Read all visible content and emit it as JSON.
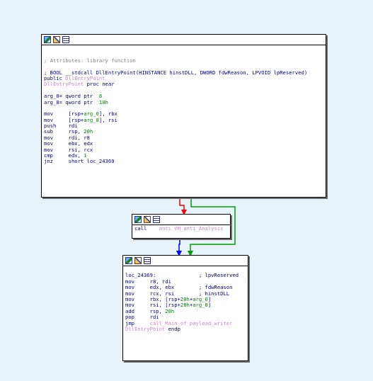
{
  "colors": {
    "background": "#e6f3fb",
    "edge_false": "#ff0000",
    "edge_true": "#00a000",
    "edge_jump": "#0000ff"
  },
  "icons": [
    "graph-icon",
    "edit-icon",
    "grid-icon"
  ],
  "block1": {
    "lines": [
      {
        "spans": []
      },
      {
        "spans": []
      },
      {
        "spans": [
          {
            "t": "; Attributes: library function",
            "c": "c-comment"
          }
        ]
      },
      {
        "spans": []
      },
      {
        "spans": [
          {
            "t": "; BOOL __stdcall DllEntryPoint(HINSTANCE hinstDLL, DWORD fdwReason, LPVOID lpReserved)",
            "c": "c-proto"
          }
        ]
      },
      {
        "spans": [
          {
            "t": "public ",
            "c": "c-kw"
          },
          {
            "t": "DllEntryPoint",
            "c": "c-func"
          }
        ]
      },
      {
        "spans": [
          {
            "t": "DllEntryPoint",
            "c": "c-func"
          },
          {
            "t": " proc near",
            "c": "c-kw"
          }
        ]
      },
      {
        "spans": []
      },
      {
        "spans": [
          {
            "t": "arg_0= qword ptr  ",
            "c": "c-kw"
          },
          {
            "t": "8",
            "c": "c-num"
          }
        ]
      },
      {
        "spans": [
          {
            "t": "arg_8= qword ptr  ",
            "c": "c-kw"
          },
          {
            "t": "10h",
            "c": "c-num"
          }
        ]
      },
      {
        "spans": []
      },
      {
        "spans": [
          {
            "t": "mov     [rsp+",
            "c": "c-kw"
          },
          {
            "t": "arg_0",
            "c": "c-var"
          },
          {
            "t": "], rbx",
            "c": "c-kw"
          }
        ]
      },
      {
        "spans": [
          {
            "t": "mov     [rsp+",
            "c": "c-kw"
          },
          {
            "t": "arg_8",
            "c": "c-var"
          },
          {
            "t": "], rsi",
            "c": "c-kw"
          }
        ]
      },
      {
        "spans": [
          {
            "t": "push    rdi",
            "c": "c-kw"
          }
        ]
      },
      {
        "spans": [
          {
            "t": "sub     rsp, ",
            "c": "c-kw"
          },
          {
            "t": "20h",
            "c": "c-num"
          }
        ]
      },
      {
        "spans": [
          {
            "t": "mov     rdi, r8",
            "c": "c-kw"
          }
        ]
      },
      {
        "spans": [
          {
            "t": "mov     ebx, edx",
            "c": "c-kw"
          }
        ]
      },
      {
        "spans": [
          {
            "t": "mov     rsi, rcx",
            "c": "c-kw"
          }
        ]
      },
      {
        "spans": [
          {
            "t": "cmp     edx, ",
            "c": "c-kw"
          },
          {
            "t": "1",
            "c": "c-num"
          }
        ]
      },
      {
        "spans": [
          {
            "t": "jnz     short loc_24369",
            "c": "c-kw"
          }
        ]
      }
    ]
  },
  "block2": {
    "lines": [
      {
        "spans": [
          {
            "t": "call    ",
            "c": "c-kw"
          },
          {
            "t": "anti_VM_anti_Analysis",
            "c": "c-func"
          }
        ]
      }
    ]
  },
  "block3": {
    "lines": [
      {
        "spans": []
      },
      {
        "spans": [
          {
            "t": "loc_24369:              ; lpvReserved",
            "c": "c-lbl"
          }
        ]
      },
      {
        "spans": [
          {
            "t": "mov     r8, rdi",
            "c": "c-kw"
          }
        ]
      },
      {
        "spans": [
          {
            "t": "mov     edx, ebx        ; fdwReason",
            "c": "c-kw"
          }
        ]
      },
      {
        "spans": [
          {
            "t": "mov     rcx, rsi        ; hinstDLL",
            "c": "c-kw"
          }
        ]
      },
      {
        "spans": [
          {
            "t": "mov     rbx, [rsp+",
            "c": "c-kw"
          },
          {
            "t": "28h",
            "c": "c-num"
          },
          {
            "t": "+",
            "c": "c-kw"
          },
          {
            "t": "arg_0",
            "c": "c-var"
          },
          {
            "t": "]",
            "c": "c-kw"
          }
        ]
      },
      {
        "spans": [
          {
            "t": "mov     rsi, [rsp+",
            "c": "c-kw"
          },
          {
            "t": "28h",
            "c": "c-num"
          },
          {
            "t": "+",
            "c": "c-kw"
          },
          {
            "t": "arg_8",
            "c": "c-var"
          },
          {
            "t": "]",
            "c": "c-kw"
          }
        ]
      },
      {
        "spans": [
          {
            "t": "add     rsp, ",
            "c": "c-kw"
          },
          {
            "t": "20h",
            "c": "c-num"
          }
        ]
      },
      {
        "spans": [
          {
            "t": "pop     rdi",
            "c": "c-kw"
          }
        ]
      },
      {
        "spans": [
          {
            "t": "jmp     ",
            "c": "c-kw"
          },
          {
            "t": "call_Main_of_payload_writer",
            "c": "c-func"
          }
        ]
      },
      {
        "spans": [
          {
            "t": "DllEntryPoint",
            "c": "c-func"
          },
          {
            "t": " endp",
            "c": "c-kw"
          }
        ]
      }
    ]
  }
}
